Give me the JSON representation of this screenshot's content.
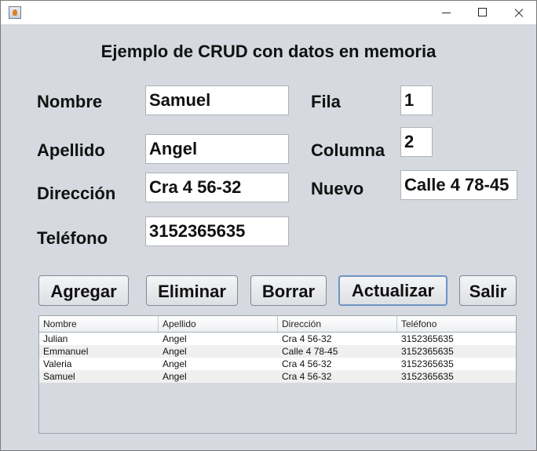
{
  "window": {
    "title": ""
  },
  "heading": "Ejemplo de CRUD con datos en memoria",
  "form": {
    "nombre": {
      "label": "Nombre",
      "value": "Samuel"
    },
    "apellido": {
      "label": "Apellido",
      "value": "Angel"
    },
    "direccion": {
      "label": "Dirección",
      "value": "Cra 4 56-32"
    },
    "telefono": {
      "label": "Teléfono",
      "value": "3152365635"
    },
    "fila": {
      "label": "Fila",
      "value": "1"
    },
    "columna": {
      "label": "Columna",
      "value": "2"
    },
    "nuevo": {
      "label": "Nuevo",
      "value": "Calle 4 78-45"
    }
  },
  "buttons": {
    "agregar": "Agregar",
    "eliminar": "Eliminar",
    "borrar": "Borrar",
    "actualizar": "Actualizar",
    "salir": "Salir"
  },
  "table": {
    "columns": [
      "Nombre",
      "Apellido",
      "Dirección",
      "Teléfono"
    ],
    "rows": [
      [
        "Julian",
        "Angel",
        "Cra 4 56-32",
        "3152365635"
      ],
      [
        "Emmanuel",
        "Angel",
        "Calle 4 78-45",
        "3152365635"
      ],
      [
        "Valeria",
        "Angel",
        "Cra 4 56-32",
        "3152365635"
      ],
      [
        "Samuel",
        "Angel",
        "Cra 4 56-32",
        "3152365635"
      ]
    ]
  },
  "icons": {
    "app": "java-app-icon",
    "minimize": "minimize-icon",
    "maximize": "maximize-icon",
    "close": "close-icon"
  }
}
